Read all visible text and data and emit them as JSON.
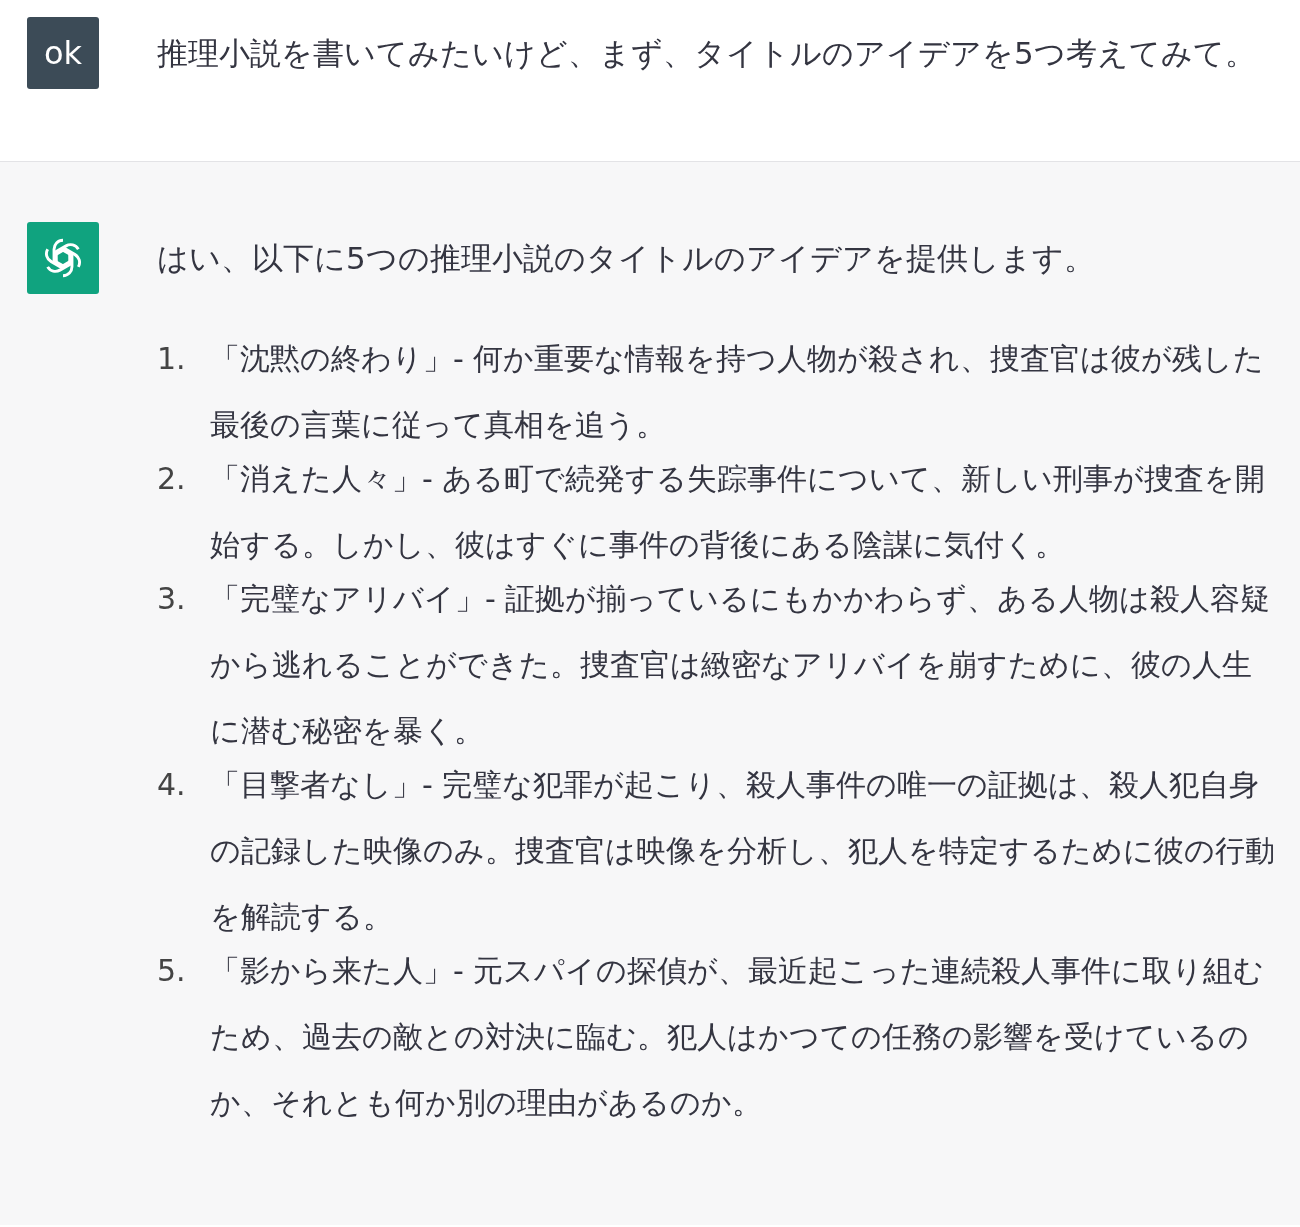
{
  "messages": [
    {
      "kind": "user",
      "avatar": "ok",
      "text": "推理小説を書いてみたいけど、まず、タイトルのアイデアを5つ考えてみて。"
    },
    {
      "kind": "assistant",
      "text": "はい、以下に5つの推理小説のタイトルのアイデアを提供します。",
      "list": [
        {
          "number": "1.",
          "text": "「沈黙の終わり」- 何か重要な情報を持つ人物が殺され、捜査官は彼が残した最後の言葉に従って真相を追う。"
        },
        {
          "number": "2.",
          "text": "「消えた人々」- ある町で続発する失踪事件について、新しい刑事が捜査を開始する。しかし、彼はすぐに事件の背後にある陰謀に気付く。"
        },
        {
          "number": "3.",
          "text": "「完璧なアリバイ」- 証拠が揃っているにもかかわらず、ある人物は殺人容疑から逃れることができた。捜査官は緻密なアリバイを崩すために、彼の人生に潜む秘密を暴く。"
        },
        {
          "number": "4.",
          "text": "「目撃者なし」- 完璧な犯罪が起こり、殺人事件の唯一の証拠は、殺人犯自身の記録した映像のみ。捜査官は映像を分析し、犯人を特定するために彼の行動を解読する。"
        },
        {
          "number": "5.",
          "text": "「影から来た人」- 元スパイの探偵が、最近起こった連続殺人事件に取り組むため、過去の敵との対決に臨む。犯人はかつての任務の影響を受けているのか、それとも何か別の理由があるのか。"
        }
      ]
    }
  ]
}
